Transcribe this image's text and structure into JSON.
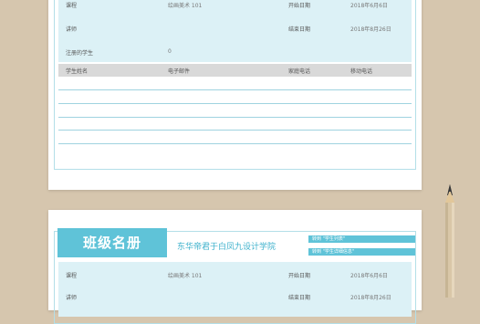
{
  "sheet1": {
    "info": {
      "course_label": "课程",
      "course_value": "绘画美术 101",
      "start_label": "开始日期",
      "start_value": "2018年6月6日",
      "teacher_label": "讲师",
      "end_label": "结束日期",
      "end_value": "2018年8月26日",
      "enrolled_label": "注册的学生",
      "enrolled_value": "0"
    },
    "table_headers": [
      "学生姓名",
      "电子邮件",
      "家庭电话",
      "移动电话"
    ]
  },
  "sheet2": {
    "title": "班级名册",
    "school": "东华帝君于白凤九设计学院",
    "goto_students": "转到 \"学生列表\"",
    "goto_details": "转到 \"学生详细信息\"",
    "info": {
      "course_label": "课程",
      "course_value": "绘画美术 101",
      "start_label": "开始日期",
      "start_value": "2018年6月6日",
      "teacher_label": "讲师",
      "end_label": "结束日期",
      "end_value": "2018年8月26日"
    }
  },
  "colors": {
    "background": "#d6c6ae",
    "accent": "#5fc3d8",
    "info_band": "#dcf1f6",
    "header_gray": "#d9d9d9"
  }
}
